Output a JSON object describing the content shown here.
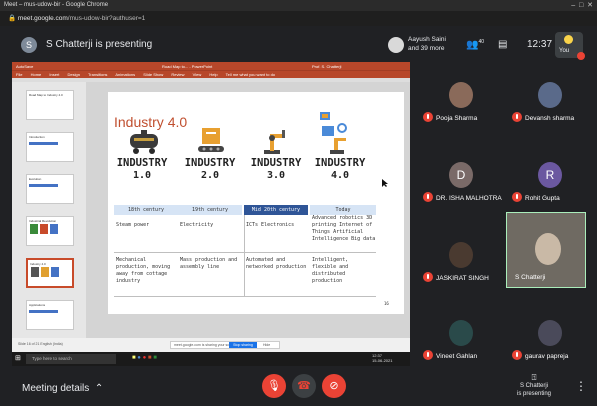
{
  "browser": {
    "title": "Meet – mus-udow-bir - Google Chrome",
    "url_host": "meet.google.com",
    "url_path": "/mus-udow-bir?authuser=1"
  },
  "meet_header": {
    "presenter_initial": "S",
    "presenting_text": "S Chatterji is presenting",
    "host_line1": "Aayush Saini",
    "host_line2": "and 39 more",
    "participants_count": "40",
    "time": "12:37",
    "you_label": "You"
  },
  "presentation": {
    "app_title": "AutoSave",
    "doc_title": "Road Map to... - PowerPoint",
    "user": "Prof. S. Chatterji",
    "ribbon": [
      "File",
      "Home",
      "Insert",
      "Design",
      "Transitions",
      "Animations",
      "Slide Show",
      "Review",
      "View",
      "Help",
      "Tell me what you want to do"
    ],
    "thumbnails": [
      {
        "num": "1",
        "title": "Road Map to Industry 4.0"
      },
      {
        "num": "2",
        "title": "Introduction"
      },
      {
        "num": "3",
        "title": "Evolution"
      },
      {
        "num": "4",
        "title": "Industrial Revolution"
      },
      {
        "num": "5",
        "title": "Industry 4.0"
      },
      {
        "num": "6",
        "title": "Applications"
      }
    ],
    "slide": {
      "title": "Industry 4.0",
      "columns": [
        {
          "title": "INDUSTRY",
          "num": "1.0",
          "era": "18th century",
          "key": "Steam power",
          "desc": "Mechanical production, moving away from cottage industry"
        },
        {
          "title": "INDUSTRY",
          "num": "2.0",
          "era": "19th century",
          "key": "Electricity",
          "desc": "Mass production and assembly line"
        },
        {
          "title": "INDUSTRY",
          "num": "3.0",
          "era": "Mid 20th century",
          "key": "ICTs Electronics",
          "desc": "Automated and networked production"
        },
        {
          "title": "INDUSTRY",
          "num": "4.0",
          "era": "Today",
          "key": "Advanced robotics 3D printing Internet of Things Artificial Intelligence Big data",
          "desc": "Intelligent, flexible and distributed production"
        }
      ],
      "page_number": "16"
    },
    "status": "Slide 16 of 21  English (India)",
    "share_bar": {
      "text": "meet.google.com is sharing your screen.",
      "stop": "Stop sharing",
      "hide": "Hide"
    },
    "taskbar_search": "Type here to search",
    "taskbar_time": "12:37",
    "taskbar_date": "15-06-2021"
  },
  "participants": [
    {
      "name": "Pooja Sharma",
      "color": "#8a6a5a"
    },
    {
      "name": "Devansh sharma",
      "color": "#5a6a8a"
    },
    {
      "name": "DR. ISHA MALHOTRA",
      "color": "#7a6a68",
      "initial": "D"
    },
    {
      "name": "Rohit Gupta",
      "color": "#6b58a0",
      "initial": "R"
    },
    {
      "name": "JASKIRAT SINGH",
      "color": "#4a3a30"
    },
    {
      "name": "S Chatterji",
      "color": "#6f6a62"
    },
    {
      "name": "Vineet Gahlan",
      "color": "#2a4a4a"
    },
    {
      "name": "gaurav papreja",
      "color": "#4a4a5a"
    }
  ],
  "bottom_bar": {
    "meeting_details": "Meeting details",
    "present_status_line1": "S Chatterji",
    "present_status_line2": "is presenting"
  },
  "colors": {
    "accent": "#c04f2f",
    "mute": "#ea4335",
    "slide_header": "#b7472a",
    "era_blue": "#4472c4"
  }
}
